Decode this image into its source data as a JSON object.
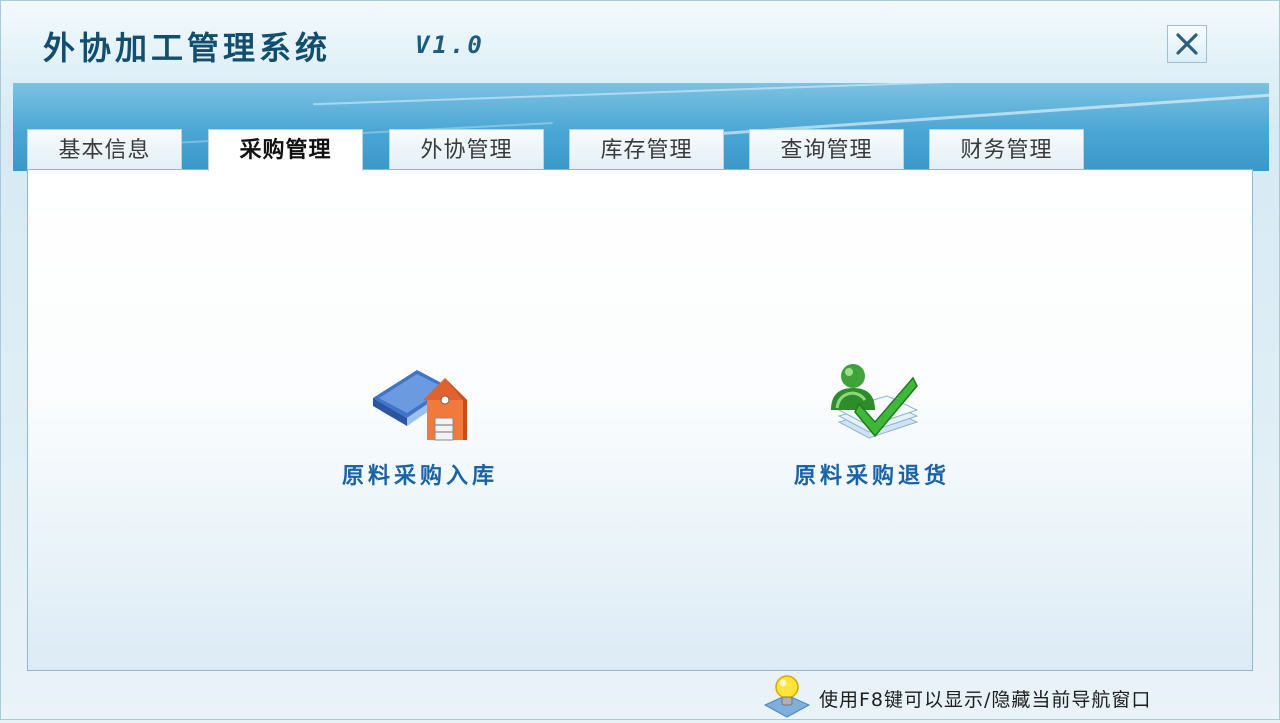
{
  "window": {
    "title": "外协加工管理系统",
    "version": "V1.0",
    "close_icon": "close-icon"
  },
  "tabs": [
    {
      "label": "基本信息",
      "active": false
    },
    {
      "label": "采购管理",
      "active": true
    },
    {
      "label": "外协管理",
      "active": false
    },
    {
      "label": "库存管理",
      "active": false
    },
    {
      "label": "查询管理",
      "active": false
    },
    {
      "label": "财务管理",
      "active": false
    }
  ],
  "actions": [
    {
      "label": "原料采购入库",
      "icon": "warehouse-book-icon"
    },
    {
      "label": "原料采购退货",
      "icon": "user-return-check-icon"
    }
  ],
  "status": {
    "hint": "使用F8键可以显示/隐藏当前导航窗口",
    "hint_icon": "lightbulb-icon"
  },
  "colors": {
    "title": "#124e6e",
    "banner": "#4aa6d4",
    "action_label": "#1a63a6",
    "content_border": "#8fb8cc"
  }
}
